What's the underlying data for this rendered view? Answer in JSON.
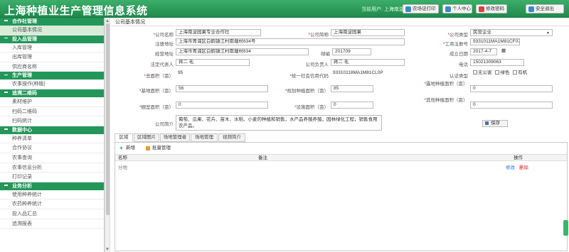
{
  "app": {
    "title": "上海种植业生产管理信息系统"
  },
  "header": {
    "user_info": "当前用户: 上海南淀园果",
    "buttons": [
      {
        "label": "农场证打印",
        "color": "#3c88c7"
      },
      {
        "label": "个人中心",
        "color": "#3c88c7"
      },
      {
        "label": "修改密码",
        "color": "#d94040"
      },
      {
        "label": "安全退出",
        "color": "#3c88c7"
      }
    ]
  },
  "sidebar": {
    "groups": [
      {
        "title": "合作社管理",
        "items": [
          "公司基本情况"
        ]
      },
      {
        "title": "投入品管理",
        "items": [
          "入库管理",
          "出库管理",
          "供应商名称"
        ]
      },
      {
        "title": "生产管理",
        "items": [
          "农事操作(种植)"
        ]
      },
      {
        "title": "追溯二维码",
        "items": [
          "素材维护",
          "扫码二维码",
          "扫码统计"
        ]
      },
      {
        "title": "数据中心",
        "items": [
          "种养清单",
          "合作协议",
          "农事查询",
          "农事信息分析",
          "打印记录"
        ]
      },
      {
        "title": "业务分析",
        "items": [
          "使用种养统计",
          "农药种养统计",
          "投入品汇总",
          "追溯报表"
        ]
      }
    ],
    "active_item": "公司基本情况"
  },
  "main": {
    "section_title": "公司基本情况",
    "form": {
      "company_name_label": "公司名称",
      "company_name": "上海南淀园果专业合作社",
      "company_short_label": "公司简称",
      "company_short": "上海南淀园果",
      "company_type_label": "公司类型",
      "company_type": "民营企业",
      "reg_address_label": "注册地址",
      "reg_address": "上海市青浦区白鹤镇江村南塘村834号",
      "reg_no_label": "工商注册号",
      "reg_no": "9331011MA1M81CF07",
      "office_address_label": "经营地址",
      "office_address": "上海市青浦区白鹤镇江村南塘村834",
      "zip_label": "邮编",
      "zip": "201709",
      "found_date_label": "成立日期",
      "found_date": "2017-4-7",
      "legal_person_label": "法定代表人",
      "legal_person": "蒋二 毛",
      "company_head_label": "公司负责人",
      "company_head": "蒋二 毛",
      "phone_label": "电话",
      "phone": "15021309063",
      "total_area_label": "总面积（亩）",
      "total_area": "95",
      "credit_code_label": "统一社会信用代码",
      "credit_code": "93310118MA1M81CL0P",
      "cert_type_label": "认证类型",
      "cert_options": [
        "无公害",
        "绿色",
        "有机"
      ],
      "base_area_label": "基地面积（亩）",
      "base_area": "56",
      "planting_area_label": "规划种植面积（亩）",
      "planting_area": "85",
      "other_area_label": "露地种植面积（亩）",
      "other_area": "0",
      "greenhouse_label": "棚室面积（亩）",
      "greenhouse": "0",
      "facility_label": "设施面积（亩）",
      "facility": "0",
      "other_plant_label": "其他种植面积（亩）",
      "other_plant": "0",
      "intro_label": "公司简介",
      "intro": "葡萄、瓜果、花卉、苗木、水稻、小麦的种植和销售，水产品养殖养殖，园林绿化工程，销售食用农产品。",
      "save_label": "保存"
    },
    "tabs": [
      "区域",
      "区域图片",
      "场地管理者",
      "场地管理",
      "视频简介"
    ],
    "toolbar": {
      "add_label": "新增",
      "edit_label": "批量管理"
    },
    "grid": {
      "columns": [
        "名称",
        "备注",
        "操作"
      ],
      "rows": [
        {
          "name": "分地",
          "note": "",
          "edit": "修改",
          "delete": "删除"
        }
      ]
    }
  }
}
